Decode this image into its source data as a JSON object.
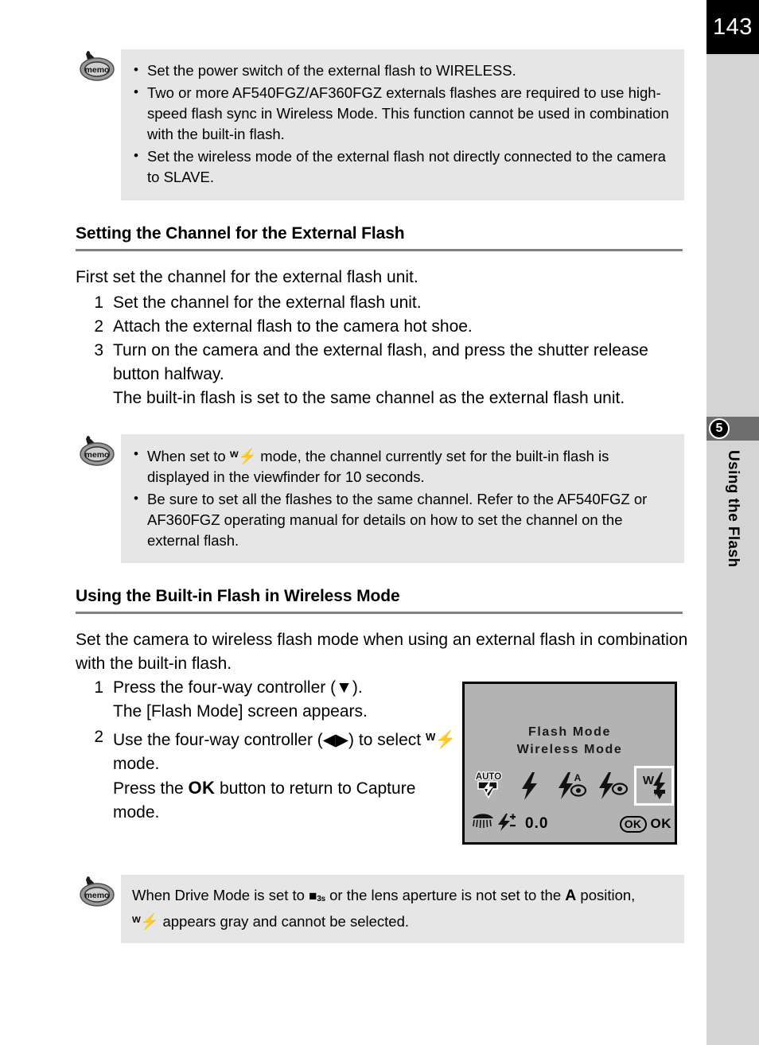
{
  "page": {
    "number": "143",
    "chapter_number": "5",
    "chapter_title": "Using the Flash"
  },
  "memo_top": {
    "icon": "memo-icon",
    "icon_label": "memo",
    "items": [
      "Set the power switch of the external flash to WIRELESS.",
      "Two or more AF540FGZ/AF360FGZ externals flashes are required to use high-speed flash sync in Wireless Mode. This function cannot be used in combination with the built-in flash.",
      "Set the wireless mode of the external flash not directly connected to the camera to SLAVE."
    ]
  },
  "section_1": {
    "heading": "Setting the Channel for the External Flash",
    "intro": "First set the channel for the external flash unit.",
    "steps": [
      {
        "num": "1",
        "text": "Set the channel for the external flash unit."
      },
      {
        "num": "2",
        "text": "Attach the external flash to the camera hot shoe."
      },
      {
        "num": "3",
        "text": "Turn on the camera and the external flash, and press the shutter release button halfway."
      }
    ],
    "step3_note": "The built-in flash is set to the same channel as the external flash unit."
  },
  "memo_middle": {
    "icon_label": "memo",
    "item1_before": "When set to ",
    "item1_after": " mode, the channel currently set for the built-in flash is displayed in the viewfinder for 10 seconds.",
    "item2": "Be sure to set all the flashes to the same channel. Refer to the AF540FGZ or AF360FGZ operating manual for details on how to set the channel on the external flash."
  },
  "section_2": {
    "heading": "Using the Built-in Flash in Wireless Mode",
    "intro": "Set the camera to wireless flash mode when using an external flash in combination with the built-in flash.",
    "step1_num": "1",
    "step1_text": "Press the four-way controller (▼).",
    "step1_note": "The [Flash Mode] screen appears.",
    "step2_num": "2",
    "step2_text_a": "Use the four-way controller (◀▶) to select ",
    "step2_text_b": " mode.",
    "step2_note_a": "Press the ",
    "step2_note_ok": "OK",
    "step2_note_b": " button to return to Capture mode."
  },
  "lcd": {
    "title_line1": "Flash Mode",
    "title_line2": "Wireless Mode",
    "icons": [
      {
        "name": "flash-auto-icon",
        "label": "AUTO",
        "selected": false
      },
      {
        "name": "flash-on-icon",
        "label": "",
        "selected": false
      },
      {
        "name": "flash-auto-redeye-icon",
        "label": "A",
        "selected": false
      },
      {
        "name": "flash-on-redeye-icon",
        "label": "",
        "selected": false
      },
      {
        "name": "flash-wireless-icon",
        "label": "W",
        "selected": true
      }
    ],
    "ev_value": "0.0",
    "ok_pill": "OK",
    "ok_label": "OK"
  },
  "memo_bottom": {
    "icon_label": "memo",
    "text_a": "When Drive Mode is set to ",
    "drive_glyph_sub": "3s",
    "text_b": " or the lens aperture is not set to the ",
    "aperture": "A",
    "text_c": " position, ",
    "text_d": " appears gray and cannot be selected."
  },
  "colors": {
    "memo_bg": "#e6e6e6",
    "sidebar_bg": "#d4d4d4",
    "chapter_band": "#6e6e6e",
    "rule": "#808080",
    "lcd_bg": "#b3b3b3",
    "page_tab": "#000000"
  }
}
